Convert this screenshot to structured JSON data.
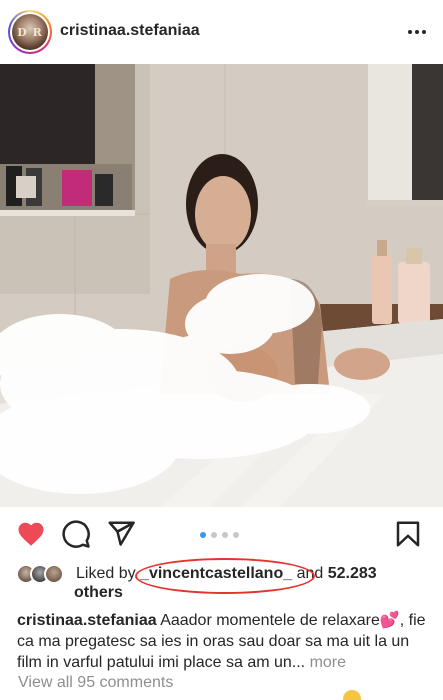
{
  "header": {
    "username": "cristinaa.stefaniaa",
    "avatar_monogram": "D R"
  },
  "post": {
    "carousel": {
      "count": 4,
      "active_index": 0
    },
    "likes": {
      "prefix": "Liked by",
      "highlighted_user": "_vincentcastellano_",
      "middle": "and",
      "count": "52.283",
      "suffix": "others"
    },
    "caption": {
      "username": "cristinaa.stefaniaa",
      "text": "Aaador momentele de relaxare💕, fie ca ma pregatesc sa ies in oras sau doar sa ma uit la un film in varful patului imi place sa am un...",
      "more_label": "more"
    },
    "view_comments": "View all 95 comments"
  },
  "colors": {
    "like": "#ed4956",
    "carousel_active": "#3897f0",
    "annotation_circle": "#e3342f"
  },
  "icons": [
    "more-horizontal-icon",
    "heart-icon",
    "comment-icon",
    "share-icon",
    "bookmark-icon"
  ]
}
